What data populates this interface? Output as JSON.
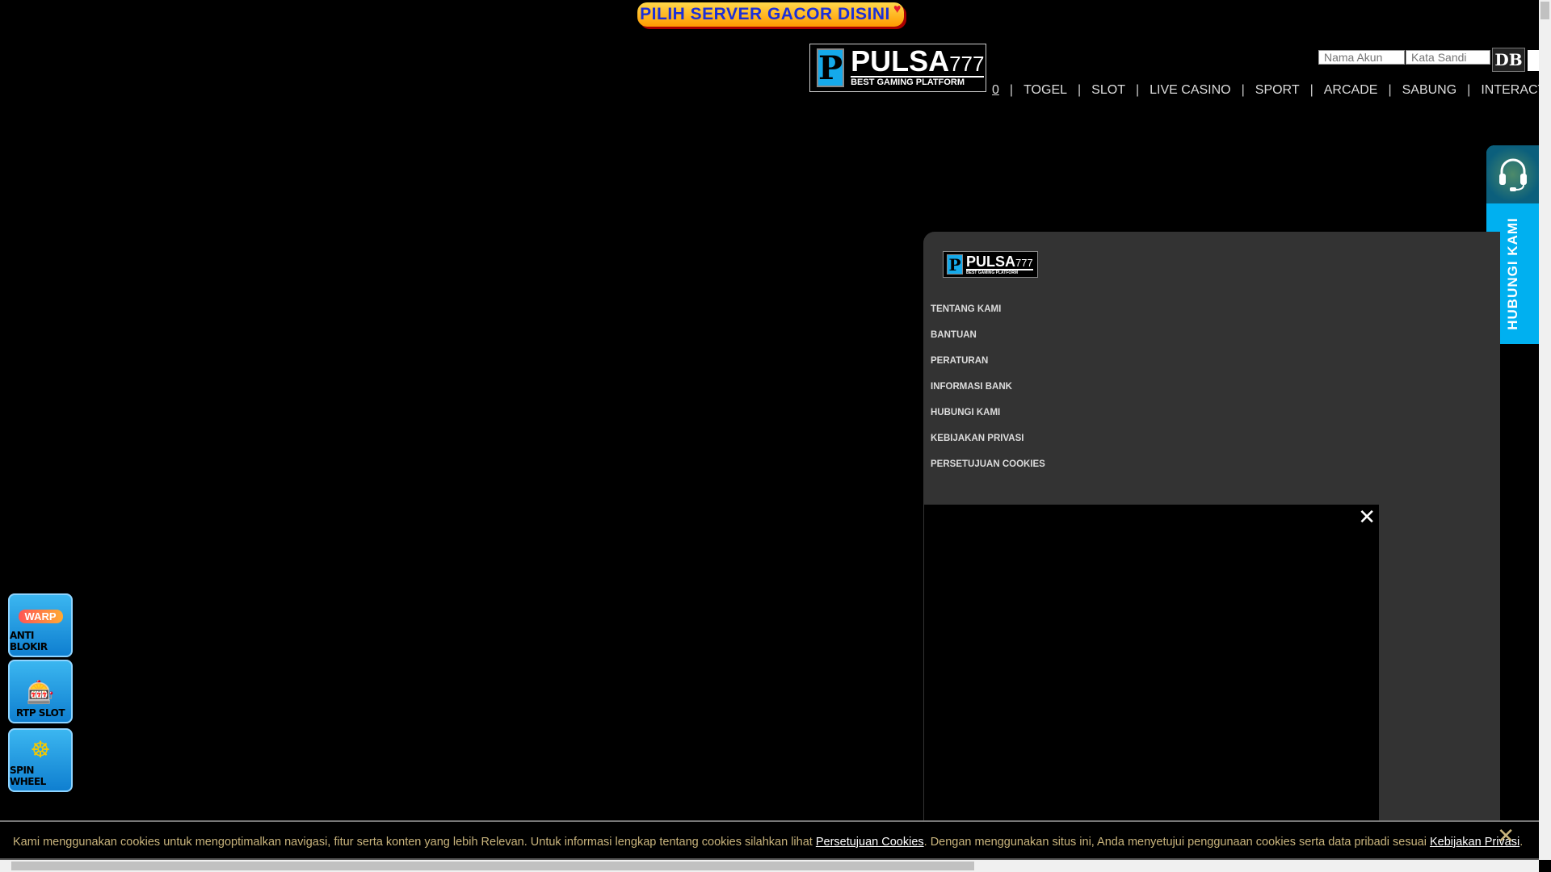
{
  "banner": {
    "label": "PILIH SERVER GACOR DISINI"
  },
  "brand": {
    "name": "PULSA",
    "suffix": "777",
    "tagline": "BEST GAMING PLATFORM",
    "initial": "P"
  },
  "login": {
    "username_placeholder": "Nama Akun",
    "password_placeholder": "Kata Sandi",
    "captcha": "DB"
  },
  "nav": {
    "items": [
      "0",
      "TOGEL",
      "SLOT",
      "LIVE CASINO",
      "SPORT",
      "ARCADE",
      "SABUNG",
      "INTERACTIVE"
    ]
  },
  "contact_tab": {
    "label": "HUBUNGI KAMI"
  },
  "footer_menu": [
    "TENTANG KAMI",
    "BANTUAN",
    "PERATURAN",
    "INFORMASI BANK",
    "HUBUNGI KAMI",
    "KEBIJAKAN PRIVASI",
    "PERSETUJUAN COOKIES"
  ],
  "side_buttons": [
    {
      "label": "ANTI BLOKIR",
      "badge": "WARP"
    },
    {
      "label": "RTP SLOT"
    },
    {
      "label": "SPIN WHEEL"
    }
  ],
  "cookie": {
    "text1": "Kami menggunakan cookies untuk mengoptimalkan navigasi, fitur serta konten yang lebih Relevan. Untuk informasi lengkap tentang cookies silahkan lihat ",
    "link1": "Persetujuan Cookies",
    "text2": ". Dengan menggunakan situs ini, Anda menyetujui penggunaan cookies serta data pribadi sesuai ",
    "link2": "Kebijakan Privasi",
    "text3": "."
  },
  "colors": {
    "accent": "#15a9ea",
    "panel": "#333333",
    "cookie_text": "#c9b47c"
  }
}
